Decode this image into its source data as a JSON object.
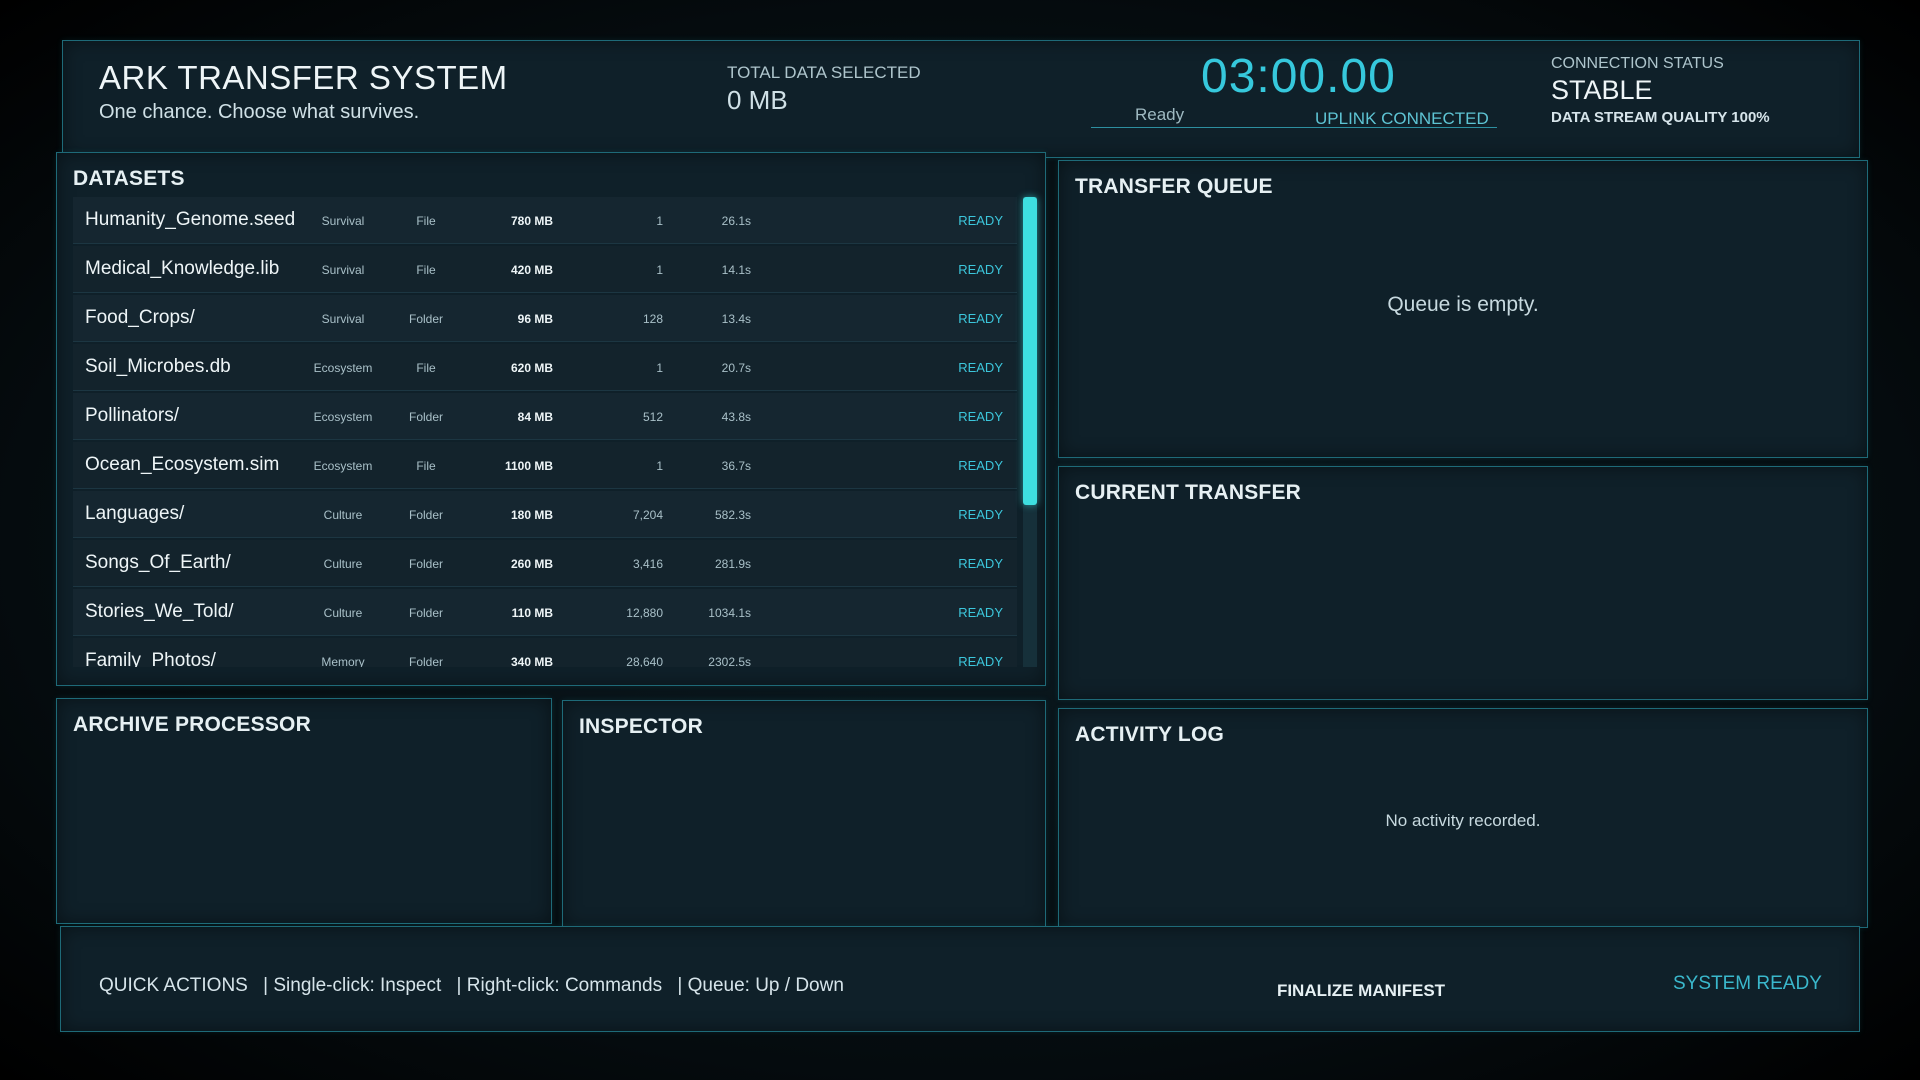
{
  "header": {
    "title": "ARK TRANSFER SYSTEM",
    "tagline": "One chance. Choose what survives.",
    "total_label": "TOTAL DATA SELECTED",
    "total_value": "0 MB",
    "timer": "03:00.00",
    "status": "Ready",
    "uplink": "UPLINK CONNECTED",
    "connection_label": "CONNECTION STATUS",
    "connection_value": "STABLE",
    "stream_quality": "DATA STREAM QUALITY 100%"
  },
  "datasets": {
    "title": "DATASETS",
    "rows": [
      {
        "name": "Humanity_Genome.seed",
        "category": "Survival",
        "type": "File",
        "size": "780 MB",
        "count": "1",
        "time": "26.1s",
        "status": "READY"
      },
      {
        "name": "Medical_Knowledge.lib",
        "category": "Survival",
        "type": "File",
        "size": "420 MB",
        "count": "1",
        "time": "14.1s",
        "status": "READY"
      },
      {
        "name": "Food_Crops/",
        "category": "Survival",
        "type": "Folder",
        "size": "96 MB",
        "count": "128",
        "time": "13.4s",
        "status": "READY"
      },
      {
        "name": "Soil_Microbes.db",
        "category": "Ecosystem",
        "type": "File",
        "size": "620 MB",
        "count": "1",
        "time": "20.7s",
        "status": "READY"
      },
      {
        "name": "Pollinators/",
        "category": "Ecosystem",
        "type": "Folder",
        "size": "84 MB",
        "count": "512",
        "time": "43.8s",
        "status": "READY"
      },
      {
        "name": "Ocean_Ecosystem.sim",
        "category": "Ecosystem",
        "type": "File",
        "size": "1100 MB",
        "count": "1",
        "time": "36.7s",
        "status": "READY"
      },
      {
        "name": "Languages/",
        "category": "Culture",
        "type": "Folder",
        "size": "180 MB",
        "count": "7,204",
        "time": "582.3s",
        "status": "READY"
      },
      {
        "name": "Songs_Of_Earth/",
        "category": "Culture",
        "type": "Folder",
        "size": "260 MB",
        "count": "3,416",
        "time": "281.9s",
        "status": "READY"
      },
      {
        "name": "Stories_We_Told/",
        "category": "Culture",
        "type": "Folder",
        "size": "110 MB",
        "count": "12,880",
        "time": "1034.1s",
        "status": "READY"
      },
      {
        "name": "Family_Photos/",
        "category": "Memory",
        "type": "Folder",
        "size": "340 MB",
        "count": "28,640",
        "time": "2302.5s",
        "status": "READY"
      }
    ]
  },
  "queue": {
    "title": "TRANSFER QUEUE",
    "empty": "Queue is empty."
  },
  "current": {
    "title": "CURRENT TRANSFER"
  },
  "archive": {
    "title": "ARCHIVE PROCESSOR"
  },
  "inspector": {
    "title": "INSPECTOR"
  },
  "activity": {
    "title": "ACTIVITY LOG",
    "empty": "No activity recorded."
  },
  "footer": {
    "quick_label": "QUICK ACTIONS",
    "hint1": "Single-click: Inspect",
    "hint2": "Right-click: Commands",
    "hint3": "Queue: Up / Down",
    "separator": "|",
    "finalize": "FINALIZE MANIFEST",
    "system_status": "SYSTEM READY"
  },
  "colors": {
    "accent": "#36c8dc",
    "panel_border": "#1e6a78",
    "scroll_thumb": "#3edfe0"
  }
}
